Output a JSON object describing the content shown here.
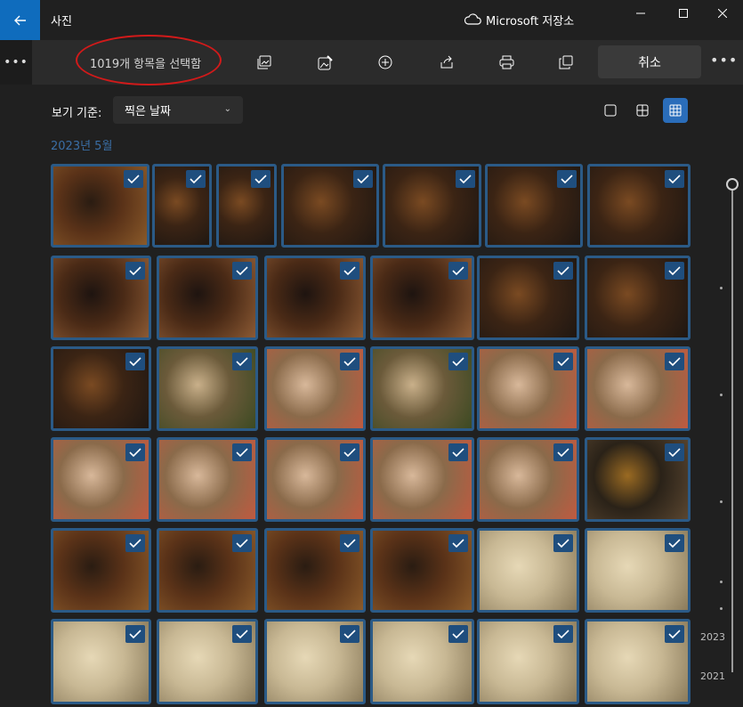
{
  "app": {
    "title": "사진"
  },
  "titlebar": {
    "storage_label": "Microsoft 저장소"
  },
  "toolbar": {
    "selection_text": "1019개 항목을 선택함",
    "cancel_label": "취소",
    "actions": [
      "copy-image-icon",
      "edit-image-icon",
      "add-icon",
      "share-icon",
      "print-icon",
      "duplicate-icon"
    ]
  },
  "view": {
    "label": "보기 기준:",
    "sort_selected": "찍은 날짜",
    "grid_modes": [
      "single",
      "medium",
      "small"
    ],
    "active_mode": "small"
  },
  "month_header": "2023년 5월",
  "colors": {
    "accent": "#0f6cbd",
    "selection_border": "#2b5a86",
    "checkbox": "#1f4e7e"
  },
  "timeline": {
    "years": [
      "2023",
      "2021"
    ]
  },
  "photos": {
    "rows": [
      [
        {
          "desc": "restaurant-interior"
        },
        {
          "desc": "skewers"
        },
        {
          "desc": "skewers"
        },
        {
          "desc": "skewers"
        },
        {
          "desc": "skewers"
        },
        {
          "desc": "skewers"
        },
        {
          "desc": "skewers"
        }
      ],
      [
        {
          "desc": "grilled-food"
        },
        {
          "desc": "grilled-food"
        },
        {
          "desc": "grilled-food"
        },
        {
          "desc": "grilled-food"
        },
        {
          "desc": "skewers"
        },
        {
          "desc": "skewers"
        }
      ],
      [
        {
          "desc": "skewers"
        },
        {
          "desc": "salad-plate"
        },
        {
          "desc": "sashimi"
        },
        {
          "desc": "salad-plate"
        },
        {
          "desc": "sashimi"
        },
        {
          "desc": "sashimi"
        }
      ],
      [
        {
          "desc": "sashimi"
        },
        {
          "desc": "sashimi"
        },
        {
          "desc": "sashimi"
        },
        {
          "desc": "sashimi"
        },
        {
          "desc": "sashimi"
        },
        {
          "desc": "beer"
        }
      ],
      [
        {
          "desc": "restaurant-interior"
        },
        {
          "desc": "restaurant-interior"
        },
        {
          "desc": "restaurant-interior"
        },
        {
          "desc": "restaurant-interior"
        },
        {
          "desc": "menu"
        },
        {
          "desc": "menu"
        }
      ],
      [
        {
          "desc": "menu"
        },
        {
          "desc": "menu"
        },
        {
          "desc": "menu"
        },
        {
          "desc": "menu"
        },
        {
          "desc": "menu"
        },
        {
          "desc": "menu"
        }
      ]
    ]
  }
}
